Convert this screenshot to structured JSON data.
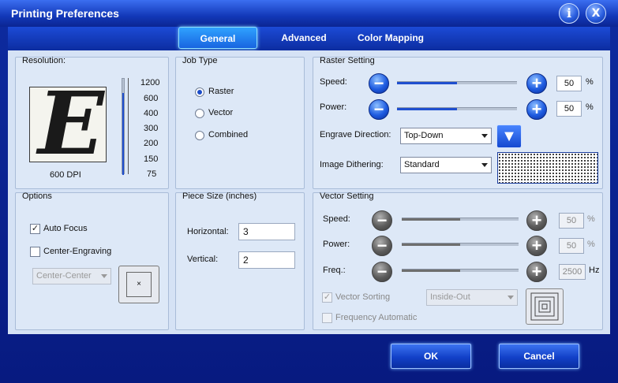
{
  "window": {
    "title": "Printing Preferences",
    "info_icon": "i",
    "close_icon": "X"
  },
  "tabs": [
    "General",
    "Advanced",
    "Color Mapping"
  ],
  "resolution": {
    "label": "Resolution:",
    "preview_letter": "E",
    "current": "600 DPI",
    "ticks": [
      "1200",
      "600",
      "400",
      "300",
      "200",
      "150",
      "75"
    ]
  },
  "job_type": {
    "label": "Job Type",
    "options": [
      "Raster",
      "Vector",
      "Combined"
    ],
    "selected": "Raster"
  },
  "raster": {
    "label": "Raster Setting",
    "speed_label": "Speed:",
    "speed_value": "50",
    "speed_unit": "%",
    "speed_level": 0.5,
    "power_label": "Power:",
    "power_value": "50",
    "power_unit": "%",
    "power_level": 0.5,
    "engrave_direction_label": "Engrave Direction:",
    "engrave_direction": "Top-Down",
    "dithering_label": "Image Dithering:",
    "dithering": "Standard"
  },
  "options": {
    "label": "Options",
    "auto_focus": "Auto Focus",
    "auto_focus_checked": true,
    "center_engraving": "Center-Engraving",
    "center_engraving_checked": false,
    "center_mode": "Center-Center"
  },
  "piece_size": {
    "label": "Piece Size (inches)",
    "horizontal_label": "Horizontal:",
    "horizontal": "3",
    "vertical_label": "Vertical:",
    "vertical": "2"
  },
  "vector": {
    "label": "Vector Setting",
    "speed_label": "Speed:",
    "speed_value": "50",
    "speed_unit": "%",
    "speed_level": 0.5,
    "power_label": "Power:",
    "power_value": "50",
    "power_unit": "%",
    "power_level": 0.5,
    "freq_label": "Freq.:",
    "freq_value": "2500",
    "freq_unit": "Hz",
    "freq_level": 0.5,
    "vector_sorting": "Vector Sorting",
    "vector_sorting_checked": true,
    "sort_mode": "Inside-Out",
    "frequency_automatic": "Frequency Automatic",
    "frequency_automatic_checked": false
  },
  "buttons": {
    "ok": "OK",
    "cancel": "Cancel"
  }
}
